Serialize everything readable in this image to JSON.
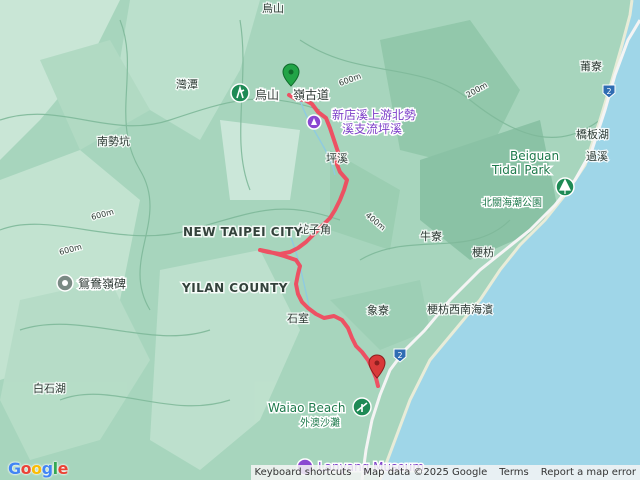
{
  "map": {
    "labels": {
      "wushan_top": "烏山",
      "wanxian": "灣潭",
      "nanshikeng": "南勢坑",
      "pinglin": "坪溪",
      "shezi": "蛇子角",
      "shijie": "石室",
      "niuliao": "牛寮",
      "xiangliao": "象寮",
      "gengfang": "梗枋",
      "gengfang_beach": "梗枋西南海濱",
      "baishihu": "白石湖",
      "puliao": "莆寮",
      "qiaobanhu": "橋板湖",
      "guoxi": "過溪",
      "elev_600a": "600m",
      "elev_600b": "600m",
      "elev_600c": "600m",
      "elev_400": "400m",
      "elev_200": "200m"
    },
    "regions": {
      "new_taipei": "NEW TAIPEI CITY",
      "yilan": "YILAN COUNTY"
    },
    "pois": {
      "trail_head": "烏山",
      "trail_name": "嶺古道",
      "xindian_line1": "新店溪上游北勢",
      "xindian_line2": "溪支流坪溪",
      "yuanyang": "鴛鴦嶺碑",
      "beiguan_en_1": "Beiguan",
      "beiguan_en_2": "Tidal Park",
      "beiguan_zh": "北關海潮公園",
      "waiao_en": "Waiao Beach",
      "waiao_zh": "外澳沙灘",
      "lanyang_en": "Lanyang Museum"
    },
    "road_shields": [
      "2",
      "2"
    ],
    "colors": {
      "route": "#f04a5e",
      "start_pin": "#22a447",
      "end_pin": "#d93a3a",
      "sea": "#9fd6e8",
      "land": "#9fcfb8",
      "purple_poi": "#8a47d1",
      "green_poi": "#1e8a55"
    }
  },
  "attribution": {
    "logo": "Google",
    "shortcuts": "Keyboard shortcuts",
    "data": "Map data ©2025 Google",
    "terms": "Terms",
    "report": "Report a map error"
  }
}
